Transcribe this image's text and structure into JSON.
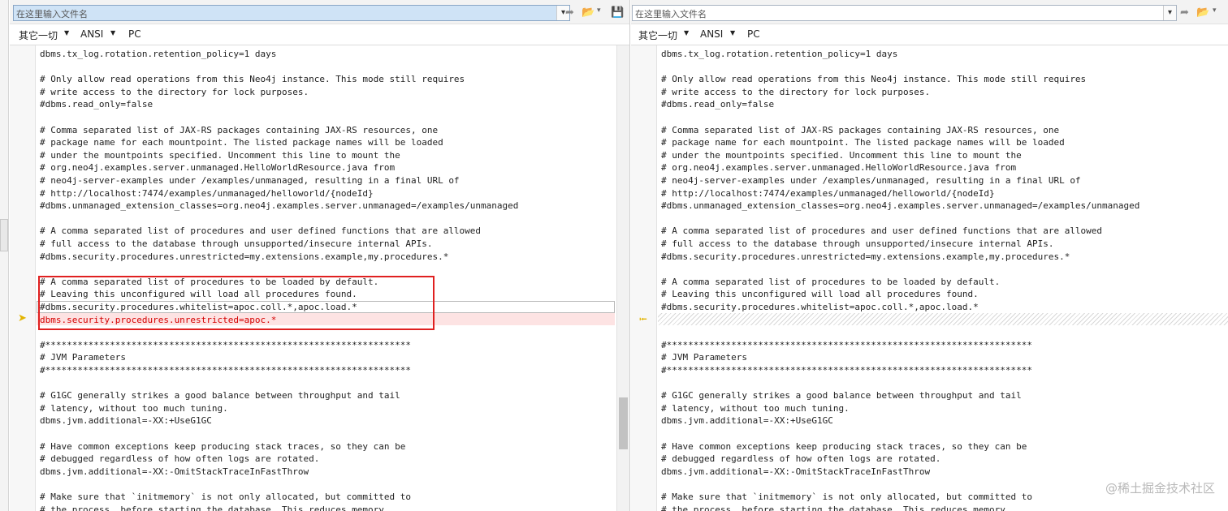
{
  "left_pane": {
    "path_placeholder": "在这里输入文件名",
    "encoding_group": "其它一切",
    "encoding": "ANSI",
    "line_ending": "PC"
  },
  "right_pane": {
    "path_placeholder": "在这里输入文件名",
    "encoding_group": "其它一切",
    "encoding": "ANSI",
    "line_ending": "PC"
  },
  "code_lines": [
    "dbms.tx_log.rotation.retention_policy=1 days",
    "",
    "# Only allow read operations from this Neo4j instance. This mode still requires",
    "# write access to the directory for lock purposes.",
    "#dbms.read_only=false",
    "",
    "# Comma separated list of JAX-RS packages containing JAX-RS resources, one",
    "# package name for each mountpoint. The listed package names will be loaded",
    "# under the mountpoints specified. Uncomment this line to mount the",
    "# org.neo4j.examples.server.unmanaged.HelloWorldResource.java from",
    "# neo4j-server-examples under /examples/unmanaged, resulting in a final URL of",
    "# http://localhost:7474/examples/unmanaged/helloworld/{nodeId}",
    "#dbms.unmanaged_extension_classes=org.neo4j.examples.server.unmanaged=/examples/unmanaged",
    "",
    "# A comma separated list of procedures and user defined functions that are allowed",
    "# full access to the database through unsupported/insecure internal APIs.",
    "#dbms.security.procedures.unrestricted=my.extensions.example,my.procedures.*",
    "",
    "# A comma separated list of procedures to be loaded by default.",
    "# Leaving this unconfigured will load all procedures found.",
    "#dbms.security.procedures.whitelist=apoc.coll.*,apoc.load.*",
    "dbms.security.procedures.unrestricted=apoc.*",
    "",
    "#********************************************************************",
    "# JVM Parameters",
    "#********************************************************************",
    "",
    "# G1GC generally strikes a good balance between throughput and tail",
    "# latency, without too much tuning.",
    "dbms.jvm.additional=-XX:+UseG1GC",
    "",
    "# Have common exceptions keep producing stack traces, so they can be",
    "# debugged regardless of how often logs are rotated.",
    "dbms.jvm.additional=-XX:-OmitStackTraceInFastThrow",
    "",
    "# Make sure that `initmemory` is not only allocated, but committed to",
    "# the process, before starting the database. This reduces memory"
  ],
  "added_line_index": 21,
  "watermark": "@稀土掘金技术社区",
  "colors": {
    "highlight_border": "#e02020",
    "added_text": "#d40000",
    "diff_arrow": "#e3b400"
  }
}
